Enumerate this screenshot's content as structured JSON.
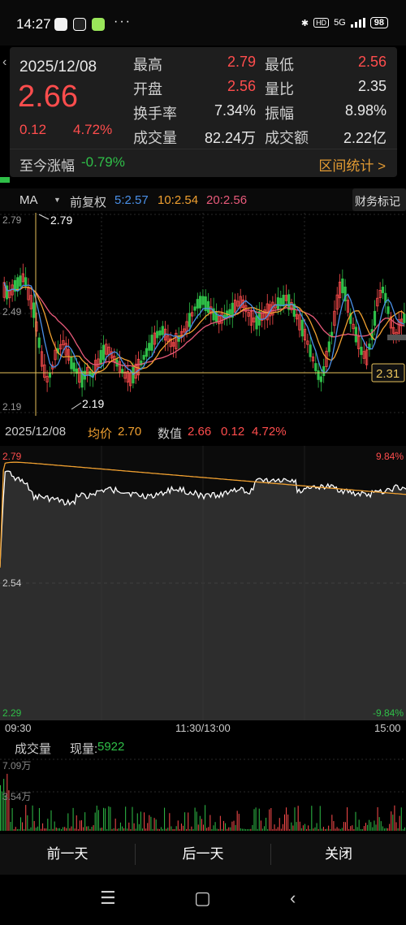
{
  "status": {
    "time": "14:27",
    "dots": "···",
    "network": "5G",
    "hd": "HD",
    "battery": "98"
  },
  "info": {
    "date": "2025/12/08",
    "price": "2.66",
    "change": "0.12",
    "change_pct": "4.72%",
    "stats": [
      {
        "label": "最高",
        "value": "2.79",
        "label2": "最低",
        "value2": "2.56"
      },
      {
        "label": "开盘",
        "value": "2.56",
        "label2": "量比",
        "value2": "2.35"
      },
      {
        "label": "换手率",
        "value": "7.34%",
        "label2": "振幅",
        "value2": "8.98%"
      },
      {
        "label": "成交量",
        "value": "82.24万",
        "label2": "成交额",
        "value2": "2.22亿"
      }
    ],
    "since_label": "至今涨幅",
    "since_value": "-0.79%",
    "range_link": "区间统计 >"
  },
  "ma_bar": {
    "ma_select": "MA",
    "dropdown_glyph": "▼",
    "adjust": "前复权",
    "ma5": "5:2.57",
    "ma10": "10:2.54",
    "ma20": "20:2.56",
    "finance_button": "财务标记"
  },
  "kline": {
    "y_high": "2.79",
    "y_mid": "2.49",
    "y_low": "2.19",
    "high_mark": "2.79",
    "low_mark": "2.19",
    "cursor_price": "2.31"
  },
  "intraday_header": {
    "date": "2025/12/08",
    "avg_label": "均价",
    "avg_value": "2.70",
    "val_label": "数值",
    "val_price": "2.66",
    "val_change": "0.12",
    "val_pct": "4.72%"
  },
  "intraday": {
    "y_top": "2.79",
    "y_mid": "2.54",
    "y_bot": "2.29",
    "pct_top": "9.84%",
    "pct_bot": "-9.84%",
    "t_start": "09:30",
    "t_mid": "11:30/13:00",
    "t_end": "15:00"
  },
  "volume": {
    "label": "成交量",
    "now_label": "现量:",
    "now_value": "5922",
    "y_top": "7.09万",
    "y_mid": "3.54万"
  },
  "bottom_nav": {
    "prev": "前一天",
    "next": "后一天",
    "close": "关闭"
  },
  "colors": {
    "up": "#ff4d4d",
    "down": "#2fbf48",
    "ma5": "#4a90e8",
    "ma10": "#f0a030",
    "ma20": "#e85a7a",
    "avg_line": "#f0a030",
    "accent": "#e39b33"
  }
}
